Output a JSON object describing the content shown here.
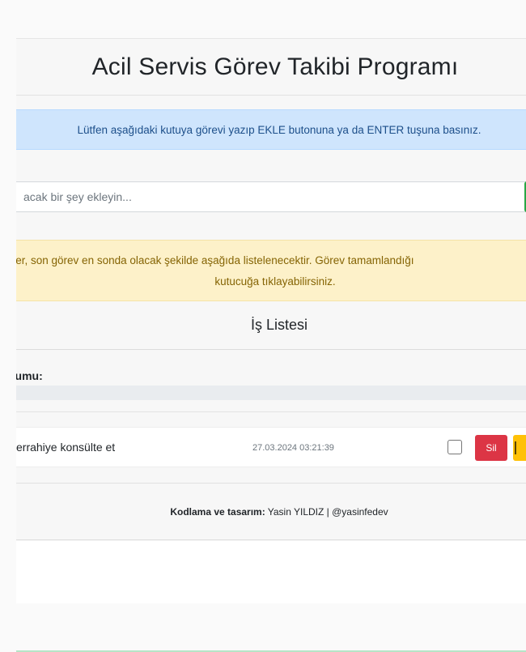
{
  "header": {
    "title": "Acil Servis Görev Takibi Programı"
  },
  "info_alert": {
    "text": "Lütfen aşağıdaki kutuya görevi yazıp EKLE butonuna ya da ENTER tuşuna basınız."
  },
  "task_input": {
    "placeholder": "acak bir şey ekleyin..."
  },
  "warning_alert": {
    "line1": "örevler, son görev en sonda olacak şekilde aşağıda listelenecektir. Görev tamamlandığı",
    "line2": "kutucuğa tıklayabilirsiniz."
  },
  "list": {
    "heading": "İş Listesi",
    "status_label": "durumu:",
    "tasks": [
      {
        "text": "i cerrahiye konsülte et",
        "date": "27.03.2024 03:21:39",
        "checked": false,
        "delete_label": "Sil"
      }
    ]
  },
  "footer": {
    "label": "Kodlama ve tasarım:",
    "credit": "Yasin YILDIZ | @yasinfedev"
  },
  "colors": {
    "info_bg": "#cfe5fd",
    "warning_bg": "#fdf1c9",
    "delete_button": "#dc3545",
    "edit_button": "#ffc107",
    "add_button": "#28a745"
  },
  "icons": {
    "edit_button_icon": "edit-icon"
  }
}
